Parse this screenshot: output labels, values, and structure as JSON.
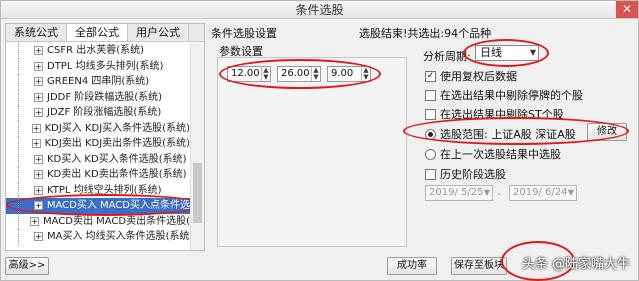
{
  "window": {
    "title": "条件选股"
  },
  "left_panel": {
    "tabs": [
      "系统公式",
      "全部公式",
      "用户公式"
    ],
    "items": [
      "CSFR 出水芙蓉(系统)",
      "DTPL 均线多头排列(系统)",
      "GREEN4 四串阴(系统)",
      "JDDF 阶段跌幅选股(系统)",
      "JDZF 阶段涨幅选股(系统)",
      "KDJ买入 KDJ买入条件选股(系统)",
      "KDJ卖出 KDJ卖出条件选股(系统)",
      "KD买入 KD买入条件选股(系统)",
      "KD卖出 KD卖出条件选股(系统)",
      "KTPL 均线空头排列(系统)",
      "MACD买入 MACD买入点条件选",
      "MACD卖出 MACD卖出条件选股(",
      "MA买入 均线买入条件选股(系统"
    ],
    "selected_index": 10
  },
  "conditions": {
    "title": "条件选股设置",
    "result": "选股结束!共选出:94个品种",
    "params_label": "参数设置",
    "params": [
      "12.00",
      "26.00",
      "9.00"
    ]
  },
  "options": {
    "period_label": "分析周期:",
    "period_value": "日线",
    "use_adjusted": "使用复权后数据",
    "exclude_suspended": "在选出结果中剔除停牌的个股",
    "exclude_st": "在选出结果中剔除ST个股",
    "range_label": "选股范围: 上证A股 深证A股",
    "range_modify": "修改",
    "prev_result": "在上一次选股结果中选股",
    "history": "历史阶段选股",
    "date_from": "2019/ 5/25",
    "date_to": "2019/ 6/24"
  },
  "footer": {
    "advanced": "高级>>",
    "success_rate": "成功率",
    "save_to_block": "保存至板块",
    "watermark": "头条 @陆家嘴大牛"
  }
}
